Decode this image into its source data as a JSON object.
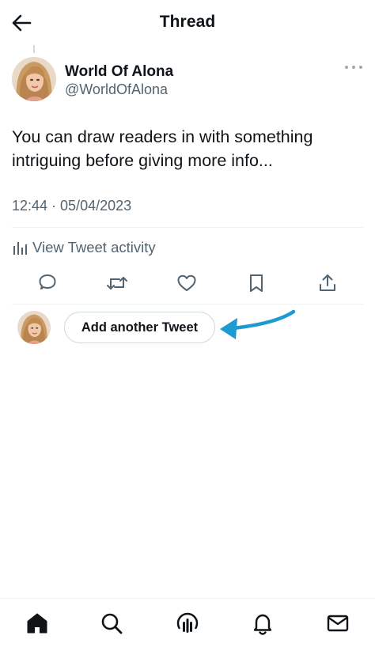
{
  "header": {
    "title": "Thread",
    "back_icon": "arrow-left-icon"
  },
  "tweet": {
    "author_name": "World Of Alona",
    "author_handle": "@WorldOfAlona",
    "text": "You can draw readers in with something intriguing before giving more info...",
    "timestamp": "12:44 · 05/04/2023",
    "activity_label": "View Tweet activity",
    "more_icon": "more-dots-icon"
  },
  "actions": [
    {
      "name": "reply",
      "icon": "reply-icon"
    },
    {
      "name": "retweet",
      "icon": "retweet-icon"
    },
    {
      "name": "like",
      "icon": "heart-icon"
    },
    {
      "name": "bookmark",
      "icon": "bookmark-icon"
    },
    {
      "name": "share",
      "icon": "share-icon"
    }
  ],
  "compose": {
    "add_tweet_label": "Add another Tweet",
    "annotation_arrow_color": "#1d9bd0"
  },
  "bottom_nav": [
    {
      "name": "home",
      "icon": "home-icon",
      "active": true
    },
    {
      "name": "search",
      "icon": "search-icon",
      "active": false
    },
    {
      "name": "spaces",
      "icon": "spaces-icon",
      "active": false
    },
    {
      "name": "notifications",
      "icon": "bell-icon",
      "active": false
    },
    {
      "name": "messages",
      "icon": "mail-icon",
      "active": false
    }
  ],
  "colors": {
    "text_primary": "#0f1419",
    "text_secondary": "#536471",
    "divider": "#eff3f4",
    "accent": "#1d9bd0"
  }
}
